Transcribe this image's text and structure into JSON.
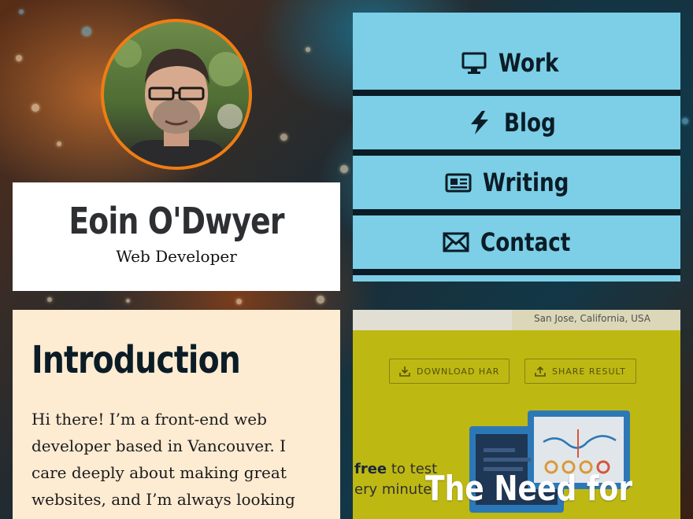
{
  "profile": {
    "name": "Eoin O'Dwyer",
    "role": "Web Developer"
  },
  "nav": {
    "items": [
      {
        "label": "Work",
        "icon": "monitor-icon"
      },
      {
        "label": "Blog",
        "icon": "lightning-icon"
      },
      {
        "label": "Writing",
        "icon": "newspaper-icon"
      },
      {
        "label": "Contact",
        "icon": "envelope-icon"
      }
    ]
  },
  "intro": {
    "heading": "Introduction",
    "body": "Hi there! I’m a front-end web developer based in Vancouver. I care deeply about making great websites, and I’m always looking for a new"
  },
  "project": {
    "location": "San Jose, California, USA",
    "download_label": "DOWNLOAD HAR",
    "share_label": "SHARE RESULT",
    "free_text_bold": "free",
    "free_text": " to test",
    "free_text_line2": "ery minute",
    "title": "The Need for"
  },
  "colors": {
    "accent_orange": "#ef7d13",
    "nav_blue": "#7ccfe6",
    "nav_dark": "#0b1c26",
    "intro_bg": "#fdebd2",
    "project_yellow": "#c9c215"
  }
}
